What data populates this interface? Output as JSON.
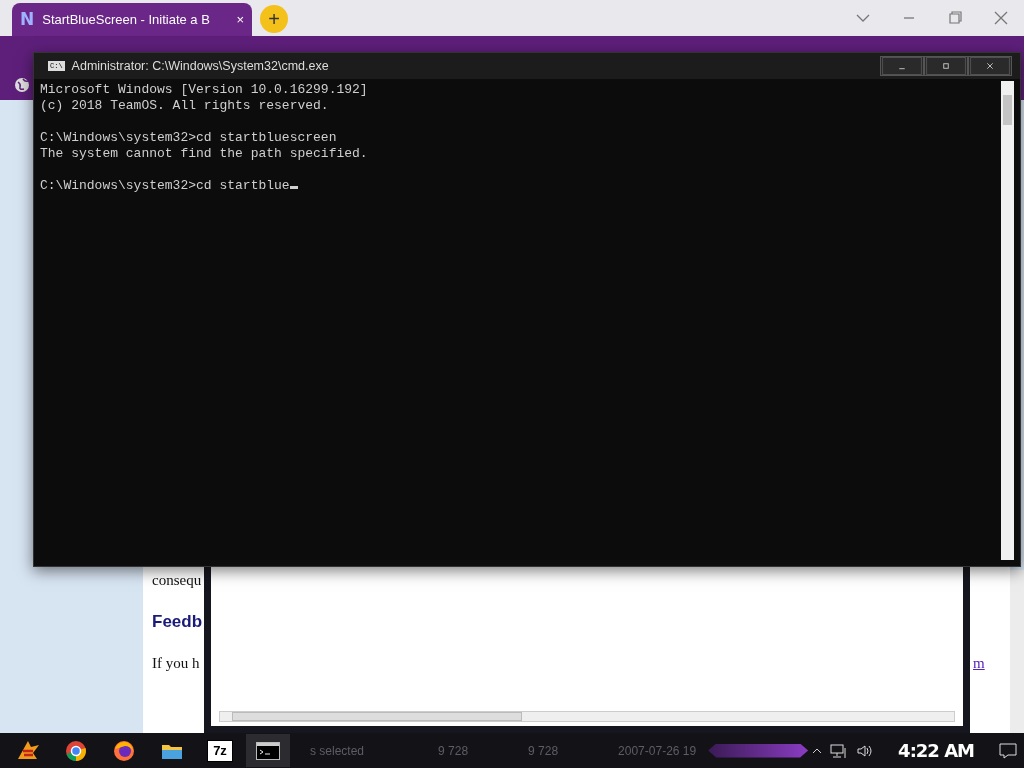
{
  "browser": {
    "tab": {
      "favicon": "N",
      "title": "StartBlueScreen - Initiate a B",
      "close": "×",
      "selected": true
    },
    "new_tab": "+"
  },
  "page": {
    "texts": [
      {
        "kind": "paragraph",
        "text": "consequ"
      },
      {
        "kind": "heading",
        "text": "Feedb"
      },
      {
        "kind": "paragraph",
        "text": "If you h"
      },
      {
        "kind": "link",
        "text": "m"
      }
    ]
  },
  "explorer": {
    "status": "s selected",
    "cells": [
      "9 728",
      "9 728",
      "2007-07-26 19"
    ]
  },
  "cmd": {
    "title": "Administrator: C:\\Windows\\System32\\cmd.exe",
    "icon": "C:\\",
    "blocks": [
      [
        "Microsoft Windows [Version 10.0.16299.192]",
        "(c) 2018 TeamOS. All rights reserved."
      ],
      [
        "C:\\Windows\\system32>cd startbluescreen",
        "The system cannot find the path specified."
      ],
      [
        "C:\\Windows\\system32>cd startblue"
      ]
    ]
  },
  "taskbar": {
    "apps": [
      {
        "kind": "start"
      },
      {
        "kind": "chrome"
      },
      {
        "kind": "firefox"
      },
      {
        "kind": "folder"
      },
      {
        "kind": "text",
        "label": "7z"
      },
      {
        "kind": "console"
      }
    ],
    "clock": "4:22 AM"
  }
}
